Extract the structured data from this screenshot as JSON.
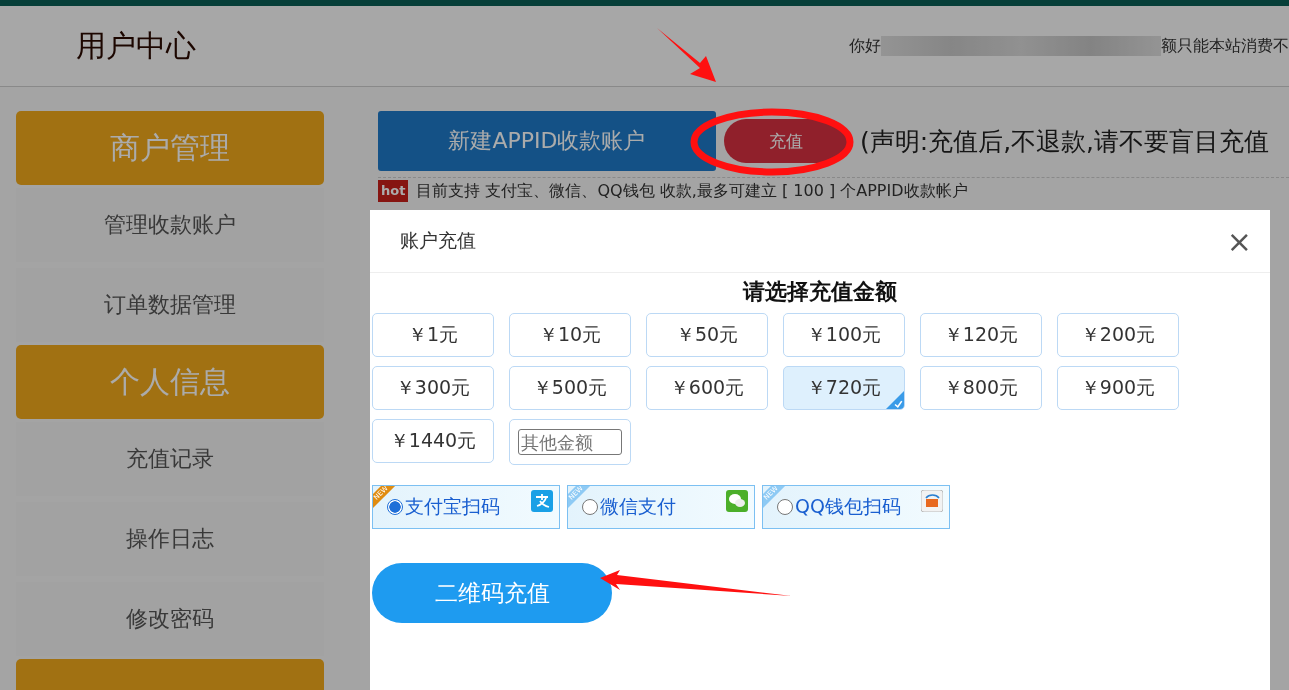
{
  "header": {
    "title": "用户中心",
    "greeting": "你好",
    "greeting_tail": "额只能本站消费不"
  },
  "sidebar": {
    "sections": [
      {
        "kind": "section",
        "title": "商户管理",
        "items": [
          "管理收款账户",
          "订单数据管理"
        ]
      },
      {
        "kind": "section",
        "title": "个人信息",
        "items": [
          "充值记录",
          "操作日志",
          "修改密码"
        ]
      },
      {
        "kind": "cut"
      }
    ]
  },
  "toolbar": {
    "new_button": "新建APPID收款账户",
    "recharge_button": "充值",
    "notice": "(声明:充值后,不退款,请不要盲目充值"
  },
  "info": {
    "badge": "hot",
    "text": "目前支持 支付宝、微信、QQ钱包 收款,最多可建立 [ 100 ] 个APPID收款帐户"
  },
  "modal": {
    "title": "账户充值",
    "close": "×",
    "heading": "请选择充值金额",
    "amounts": [
      {
        "label": "￥1元",
        "selected": false
      },
      {
        "label": "￥10元",
        "selected": false
      },
      {
        "label": "￥50元",
        "selected": false
      },
      {
        "label": "￥100元",
        "selected": false
      },
      {
        "label": "￥120元",
        "selected": false
      },
      {
        "label": "￥200元",
        "selected": false
      },
      {
        "label": "￥300元",
        "selected": false
      },
      {
        "label": "￥500元",
        "selected": false
      },
      {
        "label": "￥600元",
        "selected": false
      },
      {
        "label": "￥720元",
        "selected": true
      },
      {
        "label": "￥800元",
        "selected": false
      },
      {
        "label": "￥900元",
        "selected": false
      },
      {
        "label": "￥1440元",
        "selected": false
      }
    ],
    "other_placeholder": "其他金额",
    "payments": [
      {
        "kind": "alipay",
        "label": "支付宝扫码",
        "badge": "NEW",
        "selected": true
      },
      {
        "kind": "wechat",
        "label": "微信支付",
        "badge": "NEW",
        "selected": false
      },
      {
        "kind": "qq",
        "label": "QQ钱包扫码",
        "badge": "NEW",
        "selected": false
      }
    ],
    "submit": "二维码充值"
  }
}
